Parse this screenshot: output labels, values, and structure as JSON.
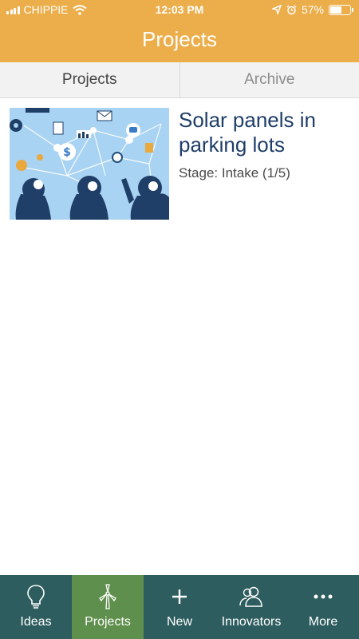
{
  "status_bar": {
    "carrier": "CHIPPIE",
    "time": "12:03 PM",
    "battery": "57%",
    "battery_level": 0.57
  },
  "header": {
    "title": "Projects"
  },
  "segments": [
    {
      "label": "Projects",
      "active": true
    },
    {
      "label": "Archive",
      "active": false
    }
  ],
  "projects": [
    {
      "title": "Solar panels in parking lots",
      "stage": "Stage: Intake (1/5)",
      "thumbnail": "ideas-network-illustration"
    }
  ],
  "tab_bar": {
    "items": [
      {
        "label": "Ideas",
        "icon": "lightbulb-icon",
        "active": false
      },
      {
        "label": "Projects",
        "icon": "wind-turbine-icon",
        "active": true
      },
      {
        "label": "New",
        "icon": "plus-icon",
        "active": false
      },
      {
        "label": "Innovators",
        "icon": "people-icon",
        "active": false
      },
      {
        "label": "More",
        "icon": "ellipsis-icon",
        "active": false
      }
    ]
  },
  "colors": {
    "header": "#EBAE4B",
    "tab_bar": "#2E5D5F",
    "tab_active": "#5E8F4C",
    "project_title": "#1F3E68",
    "thumbnail_bg": "#A9D3F2"
  }
}
